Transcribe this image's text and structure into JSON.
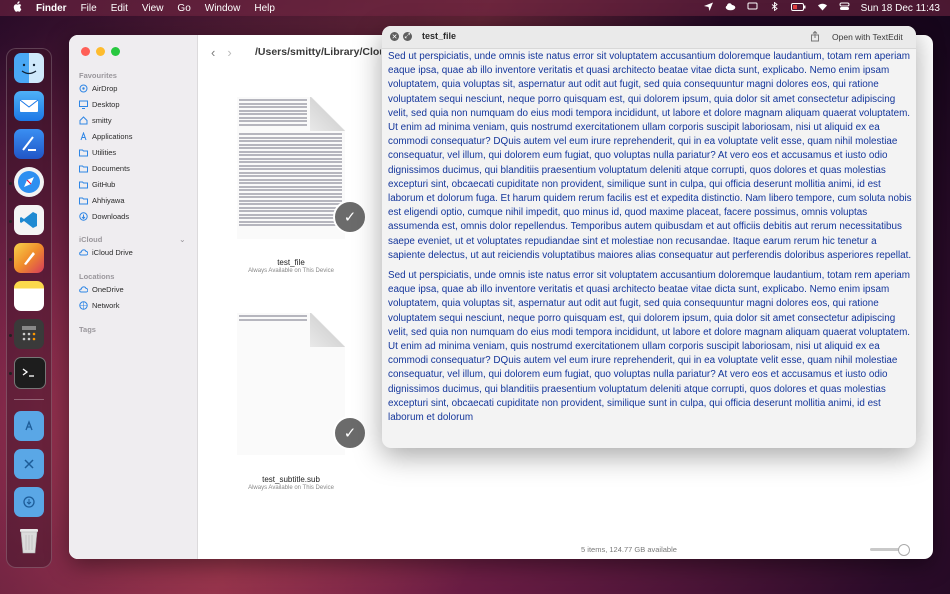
{
  "menubar": {
    "apple": "",
    "app": "Finder",
    "items": [
      "File",
      "Edit",
      "View",
      "Go",
      "Window",
      "Help"
    ],
    "clock": "Sun 18 Dec  11:43"
  },
  "finder": {
    "favourites_label": "Favourites",
    "favourites": [
      {
        "label": "AirDrop",
        "icon": "airdrop-icon"
      },
      {
        "label": "Desktop",
        "icon": "desktop-icon"
      },
      {
        "label": "smitty",
        "icon": "home-icon"
      },
      {
        "label": "Applications",
        "icon": "applications-icon"
      },
      {
        "label": "Utilities",
        "icon": "folder-icon"
      },
      {
        "label": "Documents",
        "icon": "folder-icon"
      },
      {
        "label": "GitHub",
        "icon": "folder-icon"
      },
      {
        "label": "Ahhiyawa",
        "icon": "folder-icon"
      },
      {
        "label": "Downloads",
        "icon": "downloads-icon"
      }
    ],
    "icloud_label": "iCloud",
    "icloud": [
      {
        "label": "iCloud Drive",
        "icon": "cloud-icon"
      }
    ],
    "locations_label": "Locations",
    "locations": [
      {
        "label": "OneDrive",
        "icon": "cloud-icon"
      },
      {
        "label": "Network",
        "icon": "network-icon"
      }
    ],
    "tags_label": "Tags",
    "path": "/Users/smitty/Library/Cloud",
    "files": [
      {
        "name": "test_file",
        "availability": "Always Available on This Device"
      },
      {
        "name": "test_subtitle.sub",
        "availability": "Always Available on This Device"
      }
    ],
    "status": "5 items, 124.77 GB available"
  },
  "quicklook": {
    "title": "test_file",
    "open_with": "Open with TextEdit",
    "paragraphs": [
      "Sed ut perspiciatis, unde omnis iste natus error sit voluptatem accusantium doloremque laudantium, totam rem aperiam eaque ipsa, quae ab illo inventore veritatis et quasi architecto beatae vitae dicta sunt, explicabo. Nemo enim ipsam voluptatem, quia voluptas sit, aspernatur aut odit aut fugit, sed quia consequuntur magni dolores eos, qui ratione voluptatem sequi nesciunt, neque porro quisquam est, qui dolorem ipsum, quia dolor sit amet consectetur adipiscing velit, sed quia non numquam do eius modi tempora incididunt, ut labore et dolore magnam aliquam quaerat voluptatem. Ut enim ad minima veniam, quis nostrumd exercitationem ullam corporis suscipit laboriosam, nisi ut aliquid ex ea commodi consequatur? DQuis autem vel eum irure reprehenderit, qui in ea voluptate velit esse, quam nihil molestiae consequatur, vel illum, qui dolorem eum fugiat, quo voluptas nulla pariatur? At vero eos et accusamus et iusto odio dignissimos ducimus, qui blanditiis praesentium voluptatum deleniti atque corrupti, quos dolores et quas molestias excepturi sint, obcaecati cupiditate non provident, similique sunt in culpa, qui officia deserunt mollitia animi, id est laborum et dolorum fuga. Et harum quidem rerum facilis est et expedita distinctio. Nam libero tempore, cum soluta nobis est eligendi optio, cumque nihil impedit, quo minus id, quod maxime placeat, facere possimus, omnis voluptas assumenda est, omnis dolor repellendus. Temporibus autem quibusdam et aut officiis debitis aut rerum necessitatibus saepe eveniet, ut et voluptates repudiandae sint et molestiae non recusandae. Itaque earum rerum hic tenetur a sapiente delectus, ut aut reiciendis voluptatibus maiores alias consequatur aut perferendis doloribus asperiores repellat.",
      "Sed ut perspiciatis, unde omnis iste natus error sit voluptatem accusantium doloremque laudantium, totam rem aperiam eaque ipsa, quae ab illo inventore veritatis et quasi architecto beatae vitae dicta sunt, explicabo. Nemo enim ipsam voluptatem, quia voluptas sit, aspernatur aut odit aut fugit, sed quia consequuntur magni dolores eos, qui ratione voluptatem sequi nesciunt, neque porro quisquam est, qui dolorem ipsum, quia dolor sit amet consectetur adipiscing velit, sed quia non numquam do eius modi tempora incididunt, ut labore et dolore magnam aliquam quaerat voluptatem. Ut enim ad minima veniam, quis nostrumd exercitationem ullam corporis suscipit laboriosam, nisi ut aliquid ex ea commodi consequatur? DQuis autem vel eum irure reprehenderit, qui in ea voluptate velit esse, quam nihil molestiae consequatur, vel illum, qui dolorem eum fugiat, quo voluptas nulla pariatur? At vero eos et accusamus et iusto odio dignissimos ducimus, qui blanditiis praesentium voluptatum deleniti atque corrupti, quos dolores et quas molestias excepturi sint, obcaecati cupiditate non provident, similique sunt in culpa, qui officia deserunt mollitia animi, id est laborum et dolorum"
    ]
  },
  "dock": {
    "apps": [
      "finder-icon",
      "mail-icon",
      "xcode-icon",
      "safari-icon",
      "vscode-icon",
      "pixelmator-icon",
      "notes-icon",
      "calculator-icon",
      "terminal-icon",
      "applications-folder-icon",
      "utilities-folder-icon",
      "downloads-folder-icon",
      "trash-icon"
    ]
  }
}
